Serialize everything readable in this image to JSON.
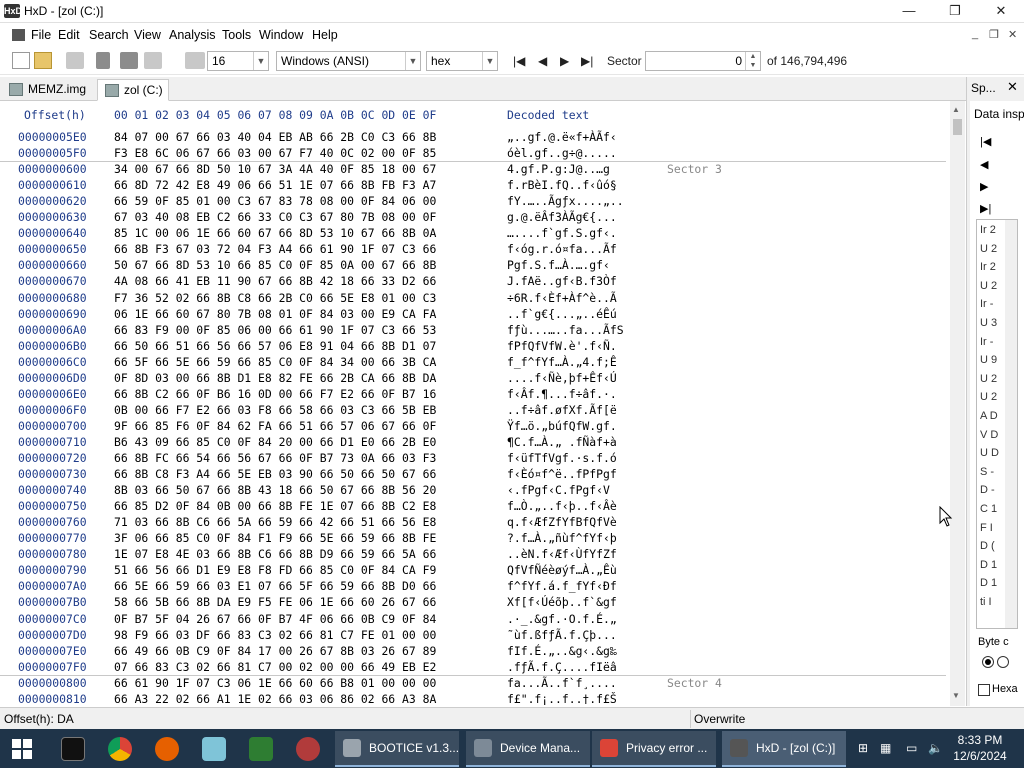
{
  "window": {
    "app_icon_text": "HxD",
    "title": "HxD - [zol (C:)]",
    "minimize": "—",
    "maximize": "❐",
    "close": "✕"
  },
  "menu": {
    "items": [
      "File",
      "Edit",
      "Search",
      "View",
      "Analysis",
      "Tools",
      "Window",
      "Help"
    ],
    "mdi_min": "_",
    "mdi_restore": "❐",
    "mdi_close": "✕"
  },
  "toolbar": {
    "bytes_per_row": "16",
    "charset": "Windows (ANSI)",
    "display_mode": "hex",
    "nav_first": "|◀",
    "nav_prev": "◀",
    "nav_next": "▶",
    "nav_last": "▶|",
    "sector_label": "Sector",
    "sector_value": "0",
    "sector_total": "of 146,794,496"
  },
  "tabs": [
    {
      "label": "MEMZ.img",
      "active": false
    },
    {
      "label": "zol (C:)",
      "active": true
    }
  ],
  "side_panel": {
    "tab_label": "Sp...",
    "close": "✕",
    "title": "Data insp",
    "list_items": [
      "Ir 2",
      "U 2",
      "Ir 2",
      "U 2",
      "Ir -",
      "U 3",
      "Ir -",
      "U 9",
      "U 2",
      "U 2",
      "A D",
      "V D",
      "U D",
      "S -",
      "D -",
      "C 1",
      "F I",
      "D (",
      "D 1",
      "D 1",
      "ti I"
    ],
    "byte_order_label": "Byte c",
    "hex_label": "Hexa"
  },
  "hex_view": {
    "header_offset": "Offset(h)",
    "header_columns": "00 01 02 03 04 05 06 07 08 09 0A 0B 0C 0D 0E 0F",
    "header_decoded": "Decoded text",
    "rows": [
      {
        "offset": "00000005E0",
        "bytes": "84 07 00 67 66 03 40 04 EB AB 66 2B C0 C3 66 8B",
        "decoded": "„..gf.@.ë«f+ÀÃf‹",
        "sector": ""
      },
      {
        "offset": "00000005F0",
        "bytes": "F3 E8 6C 06 67 66 03 00 67 F7 40 0C 02 00 0F 85",
        "decoded": "óèl.gf..g÷@.....",
        "sector": ""
      },
      {
        "offset": "0000000600",
        "bytes": "34 00 67 66 8D 50 10 67 3A 4A 40 0F 85 18 00 67",
        "decoded": "4.gf.P.g:J@..…g",
        "sector": "Sector 3"
      },
      {
        "offset": "0000000610",
        "bytes": "66 8D 72 42 E8 49 06 66 51 1E 07 66 8B FB F3 A7",
        "decoded": "f.rBèI.fQ..f‹ûó§",
        "sector": ""
      },
      {
        "offset": "0000000620",
        "bytes": "66 59 0F 85 01 00 C3 67 83 78 08 00 0F 84 06 00",
        "decoded": "fY.…..Ãgƒx....„..",
        "sector": ""
      },
      {
        "offset": "0000000630",
        "bytes": "67 03 40 08 EB C2 66 33 C0 C3 67 80 7B 08 00 0F",
        "decoded": "g.@.ëÂf3ÀÃg€{...",
        "sector": ""
      },
      {
        "offset": "0000000640",
        "bytes": "85 1C 00 06 1E 66 60 67 66 8D 53 10 67 66 8B 0A",
        "decoded": "…....f`gf.S.gf‹.",
        "sector": ""
      },
      {
        "offset": "0000000650",
        "bytes": "66 8B F3 67 03 72 04 F3 A4 66 61 90 1F 07 C3 66",
        "decoded": "f‹óg.r.ó¤fa...Ãf",
        "sector": ""
      },
      {
        "offset": "0000000660",
        "bytes": "50 67 66 8D 53 10 66 85 C0 0F 85 0A 00 67 66 8B",
        "decoded": "Pgf.S.f…À.….gf‹",
        "sector": ""
      },
      {
        "offset": "0000000670",
        "bytes": "4A 08 66 41 EB 11 90 67 66 8B 42 18 66 33 D2 66",
        "decoded": "J.fAë..gf‹B.f3Òf",
        "sector": ""
      },
      {
        "offset": "0000000680",
        "bytes": "F7 36 52 02 66 8B C8 66 2B C0 66 5E E8 01 00 C3",
        "decoded": "÷6R.f‹Èf+Àf^è..Ã",
        "sector": ""
      },
      {
        "offset": "0000000690",
        "bytes": "06 1E 66 60 67 80 7B 08 01 0F 84 03 00 E9 CA FA",
        "decoded": "..f`g€{...„..éÊú",
        "sector": ""
      },
      {
        "offset": "00000006A0",
        "bytes": "66 83 F9 00 0F 85 06 00 66 61 90 1F 07 C3 66 53",
        "decoded": "fƒù...…..fa...ÃfS",
        "sector": ""
      },
      {
        "offset": "00000006B0",
        "bytes": "66 50 66 51 66 56 66 57 06 E8 91 04 66 8B D1 07",
        "decoded": "fPfQfVfW.è'.f‹Ñ.",
        "sector": ""
      },
      {
        "offset": "00000006C0",
        "bytes": "66 5F 66 5E 66 59 66 85 C0 0F 84 34 00 66 3B CA",
        "decoded": "f_f^fYf…À.„4.f;Ê",
        "sector": ""
      },
      {
        "offset": "00000006D0",
        "bytes": "0F 8D 03 00 66 8B D1 E8 82 FE 66 2B CA 66 8B DA",
        "decoded": "....f‹Ñè‚þf+Êf‹Ú",
        "sector": ""
      },
      {
        "offset": "00000006E0",
        "bytes": "66 8B C2 66 0F B6 16 0D 00 66 F7 E2 66 0F B7 16",
        "decoded": "f‹Âf.¶...f÷âf.·.",
        "sector": ""
      },
      {
        "offset": "00000006F0",
        "bytes": "0B 00 66 F7 E2 66 03 F8 66 58 66 03 C3 66 5B EB",
        "decoded": "..f÷âf.øfXf.Ãf[ë",
        "sector": ""
      },
      {
        "offset": "0000000700",
        "bytes": "9F 66 85 F6 0F 84 62 FA 66 51 66 57 06 67 66 0F",
        "decoded": "Ÿf…ö.„búfQfW.gf.",
        "sector": ""
      },
      {
        "offset": "0000000710",
        "bytes": "B6 43 09 66 85 C0 0F 84 20 00 66 D1 E0 66 2B E0",
        "decoded": "¶C.f…À.„ .fÑàf+à",
        "sector": ""
      },
      {
        "offset": "0000000720",
        "bytes": "66 8B FC 66 54 66 56 67 66 0F B7 73 0A 66 03 F3",
        "decoded": "f‹üfTfVgf.·s.f.ó",
        "sector": ""
      },
      {
        "offset": "0000000730",
        "bytes": "66 8B C8 F3 A4 66 5E EB 03 90 66 50 66 50 67 66",
        "decoded": "f‹Èó¤f^ë..fPfPgf",
        "sector": ""
      },
      {
        "offset": "0000000740",
        "bytes": "8B 03 66 50 67 66 8B 43 18 66 50 67 66 8B 56 20",
        "decoded": "‹.fPgf‹C.fPgf‹V ",
        "sector": ""
      },
      {
        "offset": "0000000750",
        "bytes": "66 85 D2 0F 84 0B 00 66 8B FE 1E 07 66 8B C2 E8",
        "decoded": "f…Ò.„..f‹þ..f‹Âè",
        "sector": ""
      },
      {
        "offset": "0000000760",
        "bytes": "71 03 66 8B C6 66 5A 66 59 66 42 66 51 66 56 E8",
        "decoded": "q.f‹ÆfZfYfBfQfVè",
        "sector": ""
      },
      {
        "offset": "0000000770",
        "bytes": "3F 06 66 85 C0 0F 84 F1 F9 66 5E 66 59 66 8B FE",
        "decoded": "?.f…À.„ñùf^fYf‹þ",
        "sector": ""
      },
      {
        "offset": "0000000780",
        "bytes": "1E 07 E8 4E 03 66 8B C6 66 8B D9 66 59 66 5A 66",
        "decoded": "..èN.f‹Æf‹ÙfYfZf",
        "sector": ""
      },
      {
        "offset": "0000000790",
        "bytes": "51 66 56 66 D1 E9 E8 F8 FD 66 85 C0 0F 84 CA F9",
        "decoded": "QfVfÑéèøýf…À.„Êù",
        "sector": ""
      },
      {
        "offset": "00000007A0",
        "bytes": "66 5E 66 59 66 03 E1 07 66 5F 66 59 66 8B D0 66",
        "decoded": "f^fYf.á.f_fYf‹Ðf",
        "sector": ""
      },
      {
        "offset": "00000007B0",
        "bytes": "58 66 5B 66 8B DA E9 F5 FE 06 1E 66 60 26 67 66",
        "decoded": "Xf[f‹Úéõþ..f`&gf",
        "sector": ""
      },
      {
        "offset": "00000007C0",
        "bytes": "0F B7 5F 04 26 67 66 0F B7 4F 06 66 0B C9 0F 84",
        "decoded": ".·_.&gf.·O.f.É.„",
        "sector": ""
      },
      {
        "offset": "00000007D0",
        "bytes": "98 F9 66 03 DF 66 83 C3 02 66 81 C7 FE 01 00 00",
        "decoded": "˜ùf.ßfƒÃ.f.Çþ...",
        "sector": ""
      },
      {
        "offset": "00000007E0",
        "bytes": "66 49 66 0B C9 0F 84 17 00 26 67 8B 03 26 67 89",
        "decoded": "fIf.É.„..&g‹.&g‰",
        "sector": ""
      },
      {
        "offset": "00000007F0",
        "bytes": "07 66 83 C3 02 66 81 C7 00 02 00 00 66 49 EB E2",
        "decoded": ".fƒÃ.f.Ç....fIëâ",
        "sector": ""
      },
      {
        "offset": "0000000800",
        "bytes": "66 61 90 1F 07 C3 06 1E 66 60 66 B8 01 00 00 00",
        "decoded": "fa...Ã..f`f¸....",
        "sector": "Sector 4"
      },
      {
        "offset": "0000000810",
        "bytes": "66 A3 22 02 66 A1 1E 02 66 03 06 86 02 66 A3 8A",
        "decoded": "f£\".f¡..f..†.f£Š",
        "sector": ""
      }
    ]
  },
  "status": {
    "offset": "Offset(h): DA",
    "mode": "Overwrite"
  },
  "taskbar": {
    "tasks": [
      {
        "label": "BOOTICE v1.3...",
        "active": false
      },
      {
        "label": "Device Mana...",
        "active": false
      },
      {
        "label": "Privacy error ...",
        "active": false
      },
      {
        "label": "HxD - [zol (C:)]",
        "active": true
      }
    ],
    "time": "8:33 PM",
    "date": "12/6/2024"
  }
}
